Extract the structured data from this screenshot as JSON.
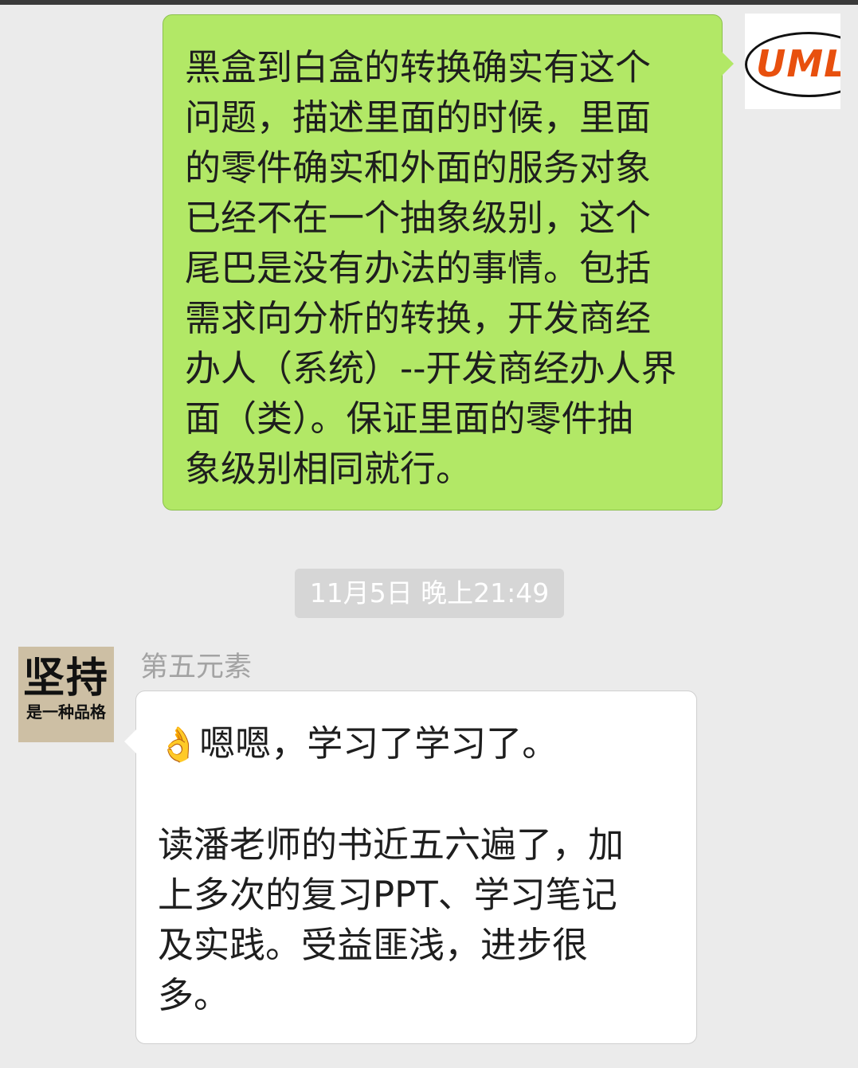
{
  "outgoing_message": {
    "lines": [
      "黑盒到白盒的转换确实有这个",
      "问题，描述里面的时候，里面",
      "的零件确实和外面的服务对象",
      "已经不在一个抽象级别，这个",
      "尾巴是没有办法的事情。包括",
      "需求向分析的转换，开发商经",
      "办人（系统）--开发商经办人界",
      "面（类）。保证里面的零件抽",
      "象级别相同就行。"
    ]
  },
  "self_avatar": {
    "logo_text": "UML"
  },
  "timestamp": "11月5日 晚上21:49",
  "incoming_message": {
    "sender": "第五元素",
    "avatar_text": {
      "big": "坚持",
      "small": "是一种品格"
    },
    "emoji": "👌",
    "emoji_icon": "ok-hand-icon",
    "first_line": "嗯嗯，学习了学习了。",
    "lines": [
      "读潘老师的书近五六遍了，加",
      "上多次的复习PPT、学习笔记",
      "及实践。受益匪浅，进步很",
      "多。"
    ]
  },
  "colors": {
    "outgoing_bubble": "#b2e866",
    "incoming_bubble": "#ffffff",
    "background": "#ebebeb",
    "uml_logo": "#e8500e"
  }
}
